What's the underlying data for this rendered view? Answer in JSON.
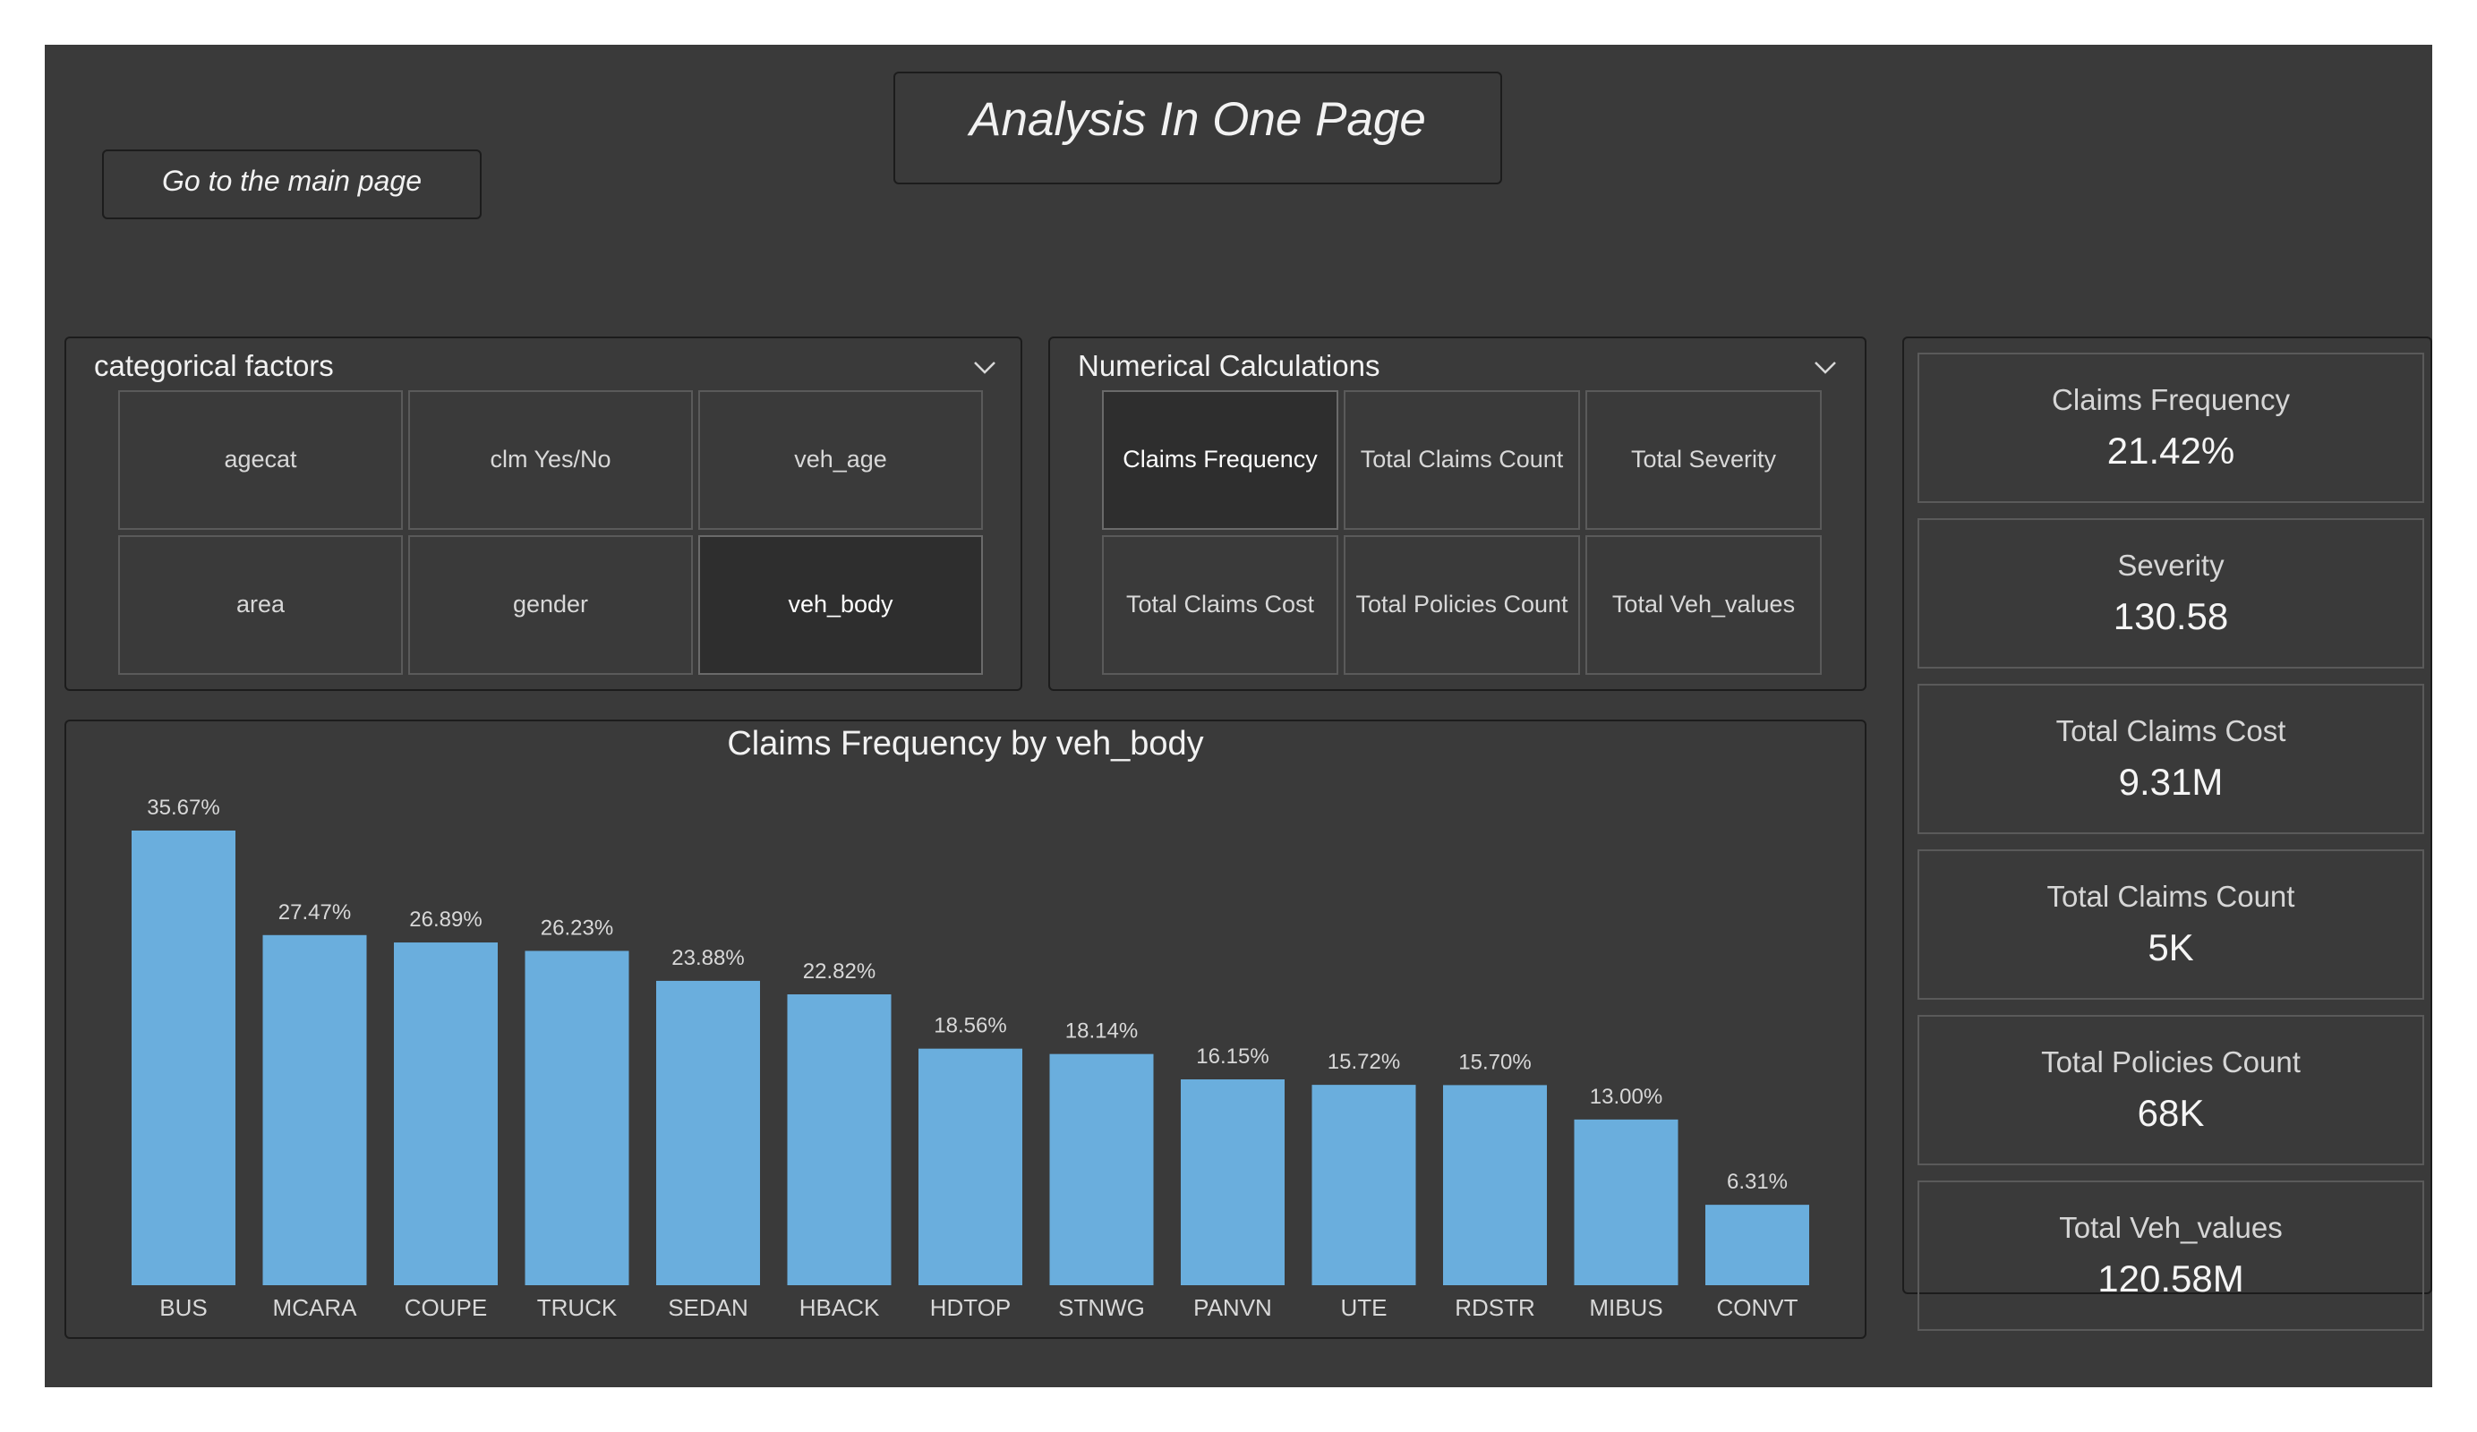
{
  "header": {
    "title": "Analysis In One Page",
    "main_page_button": "Go to the main page"
  },
  "categorical": {
    "title": "categorical factors",
    "items": [
      {
        "label": "agecat",
        "selected": false
      },
      {
        "label": "clm Yes/No",
        "selected": false
      },
      {
        "label": "veh_age",
        "selected": false
      },
      {
        "label": "area",
        "selected": false
      },
      {
        "label": "gender",
        "selected": false
      },
      {
        "label": "veh_body",
        "selected": true
      }
    ]
  },
  "numerical": {
    "title": "Numerical Calculations",
    "items": [
      {
        "label": "Claims Frequency",
        "selected": true
      },
      {
        "label": "Total Claims Count",
        "selected": false
      },
      {
        "label": "Total Severity",
        "selected": false
      },
      {
        "label": "Total Claims Cost",
        "selected": false
      },
      {
        "label": "Total Policies Count",
        "selected": false
      },
      {
        "label": "Total Veh_values",
        "selected": false
      }
    ]
  },
  "kpis": [
    {
      "label": "Claims Frequency",
      "value": "21.42%"
    },
    {
      "label": "Severity",
      "value": "130.58"
    },
    {
      "label": "Total Claims Cost",
      "value": "9.31M"
    },
    {
      "label": "Total Claims Count",
      "value": "5K"
    },
    {
      "label": "Total Policies Count",
      "value": "68K"
    },
    {
      "label": "Total Veh_values",
      "value": "120.58M"
    }
  ],
  "colors": {
    "background": "#3a3a3a",
    "bar": "#6aaedd",
    "border": "#1c1c1c"
  },
  "chart_data": {
    "type": "bar",
    "title": "Claims Frequency by veh_body",
    "categories": [
      "BUS",
      "MCARA",
      "COUPE",
      "TRUCK",
      "SEDAN",
      "HBACK",
      "HDTOP",
      "STNWG",
      "PANVN",
      "UTE",
      "RDSTR",
      "MIBUS",
      "CONVT"
    ],
    "values": [
      35.67,
      27.47,
      26.89,
      26.23,
      23.88,
      22.82,
      18.56,
      18.14,
      16.15,
      15.72,
      15.7,
      13.0,
      6.31
    ],
    "data_labels": [
      "35.67%",
      "27.47%",
      "26.89%",
      "26.23%",
      "23.88%",
      "22.82%",
      "18.56%",
      "18.14%",
      "16.15%",
      "15.72%",
      "15.70%",
      "13.00%",
      "6.31%"
    ],
    "ylim": [
      0,
      35.67
    ],
    "grid": false,
    "legend": "none"
  }
}
